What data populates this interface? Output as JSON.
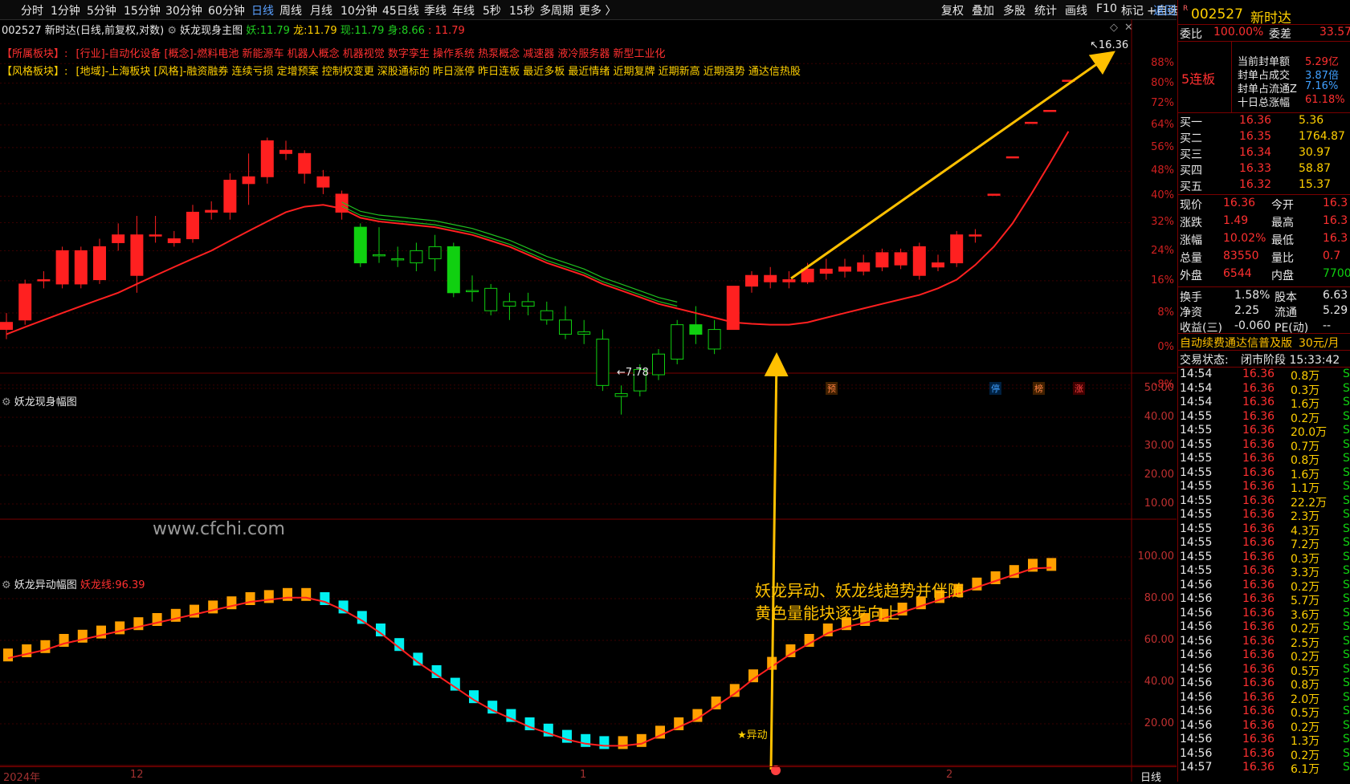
{
  "toolbar": {
    "periods": [
      "分时",
      "1分钟",
      "5分钟",
      "15分钟",
      "30分钟",
      "60分钟",
      "日线",
      "周线",
      "月线",
      "10分钟",
      "45日线",
      "季线",
      "年线",
      "5秒",
      "15秒",
      "多周期",
      "更多 〉"
    ],
    "active_period": "日线",
    "right_buttons": [
      "复权",
      "叠加",
      "多股",
      "统计",
      "画线",
      "F10",
      "标记",
      "+自选",
      "返回"
    ]
  },
  "chart_header": {
    "code": "002527",
    "name": "新时达",
    "mode": "(日线,前复权,对数)",
    "indicator": "妖龙现身主图",
    "yao_label": "妖:",
    "yao_value": "11.79",
    "long_label": "龙:",
    "long_value": "11.79",
    "xian_label": "现:",
    "xian_value": "11.79",
    "shen_label": "身:",
    "shen_value": "8.66",
    "shen_extra": ": 11.79"
  },
  "sectors": {
    "label1": "【所属板块】:",
    "text1": "[行业]-自动化设备 [概念]-燃料电池 新能源车 机器人概念 机器视觉 数字孪生 操作系统 热泵概念 减速器 液冷服务器 新型工业化",
    "label2": "【风格板块】:",
    "text2": "[地域]-上海板块 [风格]-融资融券 连续亏损 定增预案 控制权变更 深股通标的 昨日涨停 昨日连板 最近多板 最近情绪 近期复牌 近期新高 近期强势 通达信热股"
  },
  "main_axis": [
    "88%",
    "80%",
    "72%",
    "64%",
    "56%",
    "48%",
    "40%",
    "32%",
    "24%",
    "16%",
    "8%",
    "0%",
    "-8%"
  ],
  "price_labels": {
    "high": "16.36",
    "low": "7.78"
  },
  "badges": [
    "预",
    "停",
    "榜",
    "涨"
  ],
  "panel2": {
    "title": "妖龙现身幅图",
    "watermark": "www.cfchi.com",
    "axis": [
      "50.00",
      "40.00",
      "30.00",
      "20.00",
      "10.00"
    ]
  },
  "panel3": {
    "title": "妖龙异动幅图",
    "line_label": "妖龙线:",
    "line_value": "96.39",
    "axis": [
      "100.00",
      "80.00",
      "60.00",
      "40.00",
      "20.00"
    ],
    "annotation_line1": "妖龙异动、妖龙线趋势并伴随",
    "annotation_line2": "黄色量能块逐步向上",
    "signal_label": "异动"
  },
  "x_axis": {
    "labels": [
      "2024年",
      "12",
      "1",
      "2"
    ],
    "period": "日线"
  },
  "quote": {
    "code": "002527",
    "name": "新时达",
    "weibi_label": "委比",
    "weibi_value": "100.00%",
    "weicha_label": "委差",
    "weicha_value": "33.57",
    "lianban": "5连板",
    "seal_amount_label": "当前封单额",
    "seal_amount": "5.29亿",
    "seal_vol_label": "封单占成交",
    "seal_vol": "3.87倍",
    "seal_float_label": "封单占流通Z",
    "seal_float": "7.16%",
    "ten_day_label": "十日总涨幅",
    "ten_day": "61.18%",
    "bids": [
      {
        "label": "买一",
        "price": "16.36",
        "vol": "5.36"
      },
      {
        "label": "买二",
        "price": "16.35",
        "vol": "1764.87"
      },
      {
        "label": "买三",
        "price": "16.34",
        "vol": "30.97"
      },
      {
        "label": "买四",
        "price": "16.33",
        "vol": "58.87"
      },
      {
        "label": "买五",
        "price": "16.32",
        "vol": "15.37"
      }
    ],
    "stats": [
      {
        "l1": "现价",
        "v1": "16.36",
        "l2": "今开",
        "v2": "16.3"
      },
      {
        "l1": "涨跌",
        "v1": "1.49",
        "l2": "最高",
        "v2": "16.3"
      },
      {
        "l1": "涨幅",
        "v1": "10.02%",
        "l2": "最低",
        "v2": "16.3"
      },
      {
        "l1": "总量",
        "v1": "83550",
        "l2": "量比",
        "v2": "0.7"
      },
      {
        "l1": "外盘",
        "v1": "6544",
        "l2": "内盘",
        "v2": "7700"
      }
    ],
    "stats2": [
      {
        "l1": "换手",
        "v1": "1.58%",
        "l2": "股本",
        "v2": "6.63"
      },
      {
        "l1": "净资",
        "v1": "2.25",
        "l2": "流通",
        "v2": "5.29"
      },
      {
        "l1": "收益(三)",
        "v1": "-0.060",
        "l2": "PE(动)",
        "v2": "--"
      }
    ],
    "promo": "自动续费通达信普及版",
    "promo_price": "30元/月",
    "status_label": "交易状态:",
    "status_value": "闭市阶段 15:33:42"
  },
  "ticks": [
    {
      "t": "14:54",
      "p": "16.36",
      "v": "0.8万",
      "s": "S"
    },
    {
      "t": "14:54",
      "p": "16.36",
      "v": "0.3万",
      "s": "S"
    },
    {
      "t": "14:54",
      "p": "16.36",
      "v": "1.6万",
      "s": "S"
    },
    {
      "t": "14:55",
      "p": "16.36",
      "v": "0.2万",
      "s": "S"
    },
    {
      "t": "14:55",
      "p": "16.36",
      "v": "20.0万",
      "s": "S"
    },
    {
      "t": "14:55",
      "p": "16.36",
      "v": "0.7万",
      "s": "S"
    },
    {
      "t": "14:55",
      "p": "16.36",
      "v": "0.8万",
      "s": "S"
    },
    {
      "t": "14:55",
      "p": "16.36",
      "v": "1.6万",
      "s": "S"
    },
    {
      "t": "14:55",
      "p": "16.36",
      "v": "1.1万",
      "s": "S"
    },
    {
      "t": "14:55",
      "p": "16.36",
      "v": "22.2万",
      "s": "S"
    },
    {
      "t": "14:55",
      "p": "16.36",
      "v": "2.3万",
      "s": "S"
    },
    {
      "t": "14:55",
      "p": "16.36",
      "v": "4.3万",
      "s": "S"
    },
    {
      "t": "14:55",
      "p": "16.36",
      "v": "7.2万",
      "s": "S"
    },
    {
      "t": "14:55",
      "p": "16.36",
      "v": "0.3万",
      "s": "S"
    },
    {
      "t": "14:55",
      "p": "16.36",
      "v": "3.3万",
      "s": "S"
    },
    {
      "t": "14:56",
      "p": "16.36",
      "v": "0.2万",
      "s": "S"
    },
    {
      "t": "14:56",
      "p": "16.36",
      "v": "5.7万",
      "s": "S"
    },
    {
      "t": "14:56",
      "p": "16.36",
      "v": "3.6万",
      "s": "S"
    },
    {
      "t": "14:56",
      "p": "16.36",
      "v": "0.2万",
      "s": "S"
    },
    {
      "t": "14:56",
      "p": "16.36",
      "v": "2.5万",
      "s": "S"
    },
    {
      "t": "14:56",
      "p": "16.36",
      "v": "0.2万",
      "s": "S"
    },
    {
      "t": "14:56",
      "p": "16.36",
      "v": "0.5万",
      "s": "S"
    },
    {
      "t": "14:56",
      "p": "16.36",
      "v": "0.8万",
      "s": "S"
    },
    {
      "t": "14:56",
      "p": "16.36",
      "v": "2.0万",
      "s": "S"
    },
    {
      "t": "14:56",
      "p": "16.36",
      "v": "0.5万",
      "s": "S"
    },
    {
      "t": "14:56",
      "p": "16.36",
      "v": "0.2万",
      "s": "S"
    },
    {
      "t": "14:56",
      "p": "16.36",
      "v": "1.3万",
      "s": "S"
    },
    {
      "t": "14:56",
      "p": "16.36",
      "v": "0.2万",
      "s": "S"
    },
    {
      "t": "14:57",
      "p": "16.36",
      "v": "6.1万",
      "s": "S"
    }
  ],
  "chart_data": [
    {
      "type": "candlestick",
      "title": "妖龙现身主图",
      "candles": [
        {
          "o": 9.4,
          "c": 9.55,
          "h": 9.75,
          "l": 9.2
        },
        {
          "o": 9.6,
          "c": 10.4,
          "h": 10.5,
          "l": 9.5
        },
        {
          "o": 10.5,
          "c": 10.5,
          "h": 10.7,
          "l": 10.3
        },
        {
          "o": 10.4,
          "c": 11.2,
          "h": 11.3,
          "l": 10.3
        },
        {
          "o": 11.2,
          "c": 10.4,
          "h": 11.3,
          "l": 10.3
        },
        {
          "o": 10.5,
          "c": 11.3,
          "h": 11.5,
          "l": 10.4
        },
        {
          "o": 11.4,
          "c": 11.6,
          "h": 11.9,
          "l": 11.2
        },
        {
          "o": 11.6,
          "c": 10.6,
          "h": 12.1,
          "l": 10.2
        },
        {
          "o": 11.6,
          "c": 11.6,
          "h": 12.1,
          "l": 11.4
        },
        {
          "o": 11.4,
          "c": 11.5,
          "h": 11.7,
          "l": 11.3
        },
        {
          "o": 11.5,
          "c": 12.2,
          "h": 12.4,
          "l": 11.4
        },
        {
          "o": 12.2,
          "c": 12.25,
          "h": 12.5,
          "l": 12.0
        },
        {
          "o": 12.2,
          "c": 13.1,
          "h": 13.3,
          "l": 12.0
        },
        {
          "o": 13.0,
          "c": 13.2,
          "h": 13.9,
          "l": 12.4
        },
        {
          "o": 13.2,
          "c": 14.3,
          "h": 14.4,
          "l": 13.0
        },
        {
          "o": 14.0,
          "c": 13.9,
          "h": 14.3,
          "l": 13.7
        },
        {
          "o": 13.9,
          "c": 13.3,
          "h": 14.0,
          "l": 13.0
        },
        {
          "o": 13.2,
          "c": 12.9,
          "h": 13.4,
          "l": 12.7
        },
        {
          "o": 12.7,
          "c": 12.2,
          "h": 12.8,
          "l": 12.0
        },
        {
          "o": 11.8,
          "c": 10.9,
          "h": 11.9,
          "l": 10.8
        },
        {
          "o": 11.1,
          "c": 11.1,
          "h": 11.8,
          "l": 10.9
        },
        {
          "o": 11.0,
          "c": 11.0,
          "h": 11.3,
          "l": 10.8
        },
        {
          "o": 10.9,
          "c": 11.2,
          "h": 11.4,
          "l": 10.7
        },
        {
          "o": 11.0,
          "c": 11.3,
          "h": 11.6,
          "l": 10.7
        },
        {
          "o": 11.3,
          "c": 10.2,
          "h": 11.4,
          "l": 10.1
        },
        {
          "o": 10.25,
          "c": 10.25,
          "h": 10.6,
          "l": 10.0
        },
        {
          "o": 9.8,
          "c": 10.3,
          "h": 10.4,
          "l": 9.7
        },
        {
          "o": 9.9,
          "c": 10.0,
          "h": 10.2,
          "l": 9.6
        },
        {
          "o": 9.9,
          "c": 10.0,
          "h": 10.2,
          "l": 9.7
        },
        {
          "o": 9.6,
          "c": 9.8,
          "h": 10.0,
          "l": 9.5
        },
        {
          "o": 9.3,
          "c": 9.6,
          "h": 9.9,
          "l": 9.2
        },
        {
          "o": 9.3,
          "c": 9.35,
          "h": 9.6,
          "l": 9.1
        },
        {
          "o": 8.3,
          "c": 9.2,
          "h": 9.4,
          "l": 8.2
        },
        {
          "o": 8.1,
          "c": 8.15,
          "h": 8.3,
          "l": 7.78
        },
        {
          "o": 8.2,
          "c": 8.6,
          "h": 8.7,
          "l": 8.1
        },
        {
          "o": 8.5,
          "c": 8.9,
          "h": 9.0,
          "l": 8.4
        },
        {
          "o": 8.8,
          "c": 9.5,
          "h": 9.6,
          "l": 8.7
        },
        {
          "o": 9.5,
          "c": 9.3,
          "h": 9.9,
          "l": 9.1
        },
        {
          "o": 9.0,
          "c": 9.4,
          "h": 9.6,
          "l": 8.9
        },
        {
          "o": 9.4,
          "c": 10.35,
          "h": 10.35,
          "l": 9.4
        },
        {
          "o": 10.35,
          "c": 10.6,
          "h": 10.7,
          "l": 10.2
        },
        {
          "o": 10.45,
          "c": 10.6,
          "h": 10.8,
          "l": 10.3
        },
        {
          "o": 10.45,
          "c": 10.5,
          "h": 10.7,
          "l": 10.3
        },
        {
          "o": 10.45,
          "c": 10.75,
          "h": 10.9,
          "l": 10.4
        },
        {
          "o": 10.75,
          "c": 10.65,
          "h": 11.0,
          "l": 10.5
        },
        {
          "o": 10.7,
          "c": 10.8,
          "h": 11.0,
          "l": 10.55
        },
        {
          "o": 10.7,
          "c": 10.9,
          "h": 11.1,
          "l": 10.6
        },
        {
          "o": 11.15,
          "c": 10.8,
          "h": 11.25,
          "l": 10.7
        },
        {
          "o": 10.85,
          "c": 11.15,
          "h": 11.25,
          "l": 10.75
        },
        {
          "o": 10.6,
          "c": 11.3,
          "h": 11.4,
          "l": 10.5
        },
        {
          "o": 10.8,
          "c": 10.9,
          "h": 11.1,
          "l": 10.7
        },
        {
          "o": 11.6,
          "c": 10.9,
          "h": 11.7,
          "l": 10.8
        },
        {
          "o": 11.6,
          "c": 11.6,
          "h": 11.75,
          "l": 11.4
        },
        {
          "o": 12.7,
          "c": 12.7,
          "h": 12.7,
          "l": 12.7
        },
        {
          "o": 13.8,
          "c": 13.8,
          "h": 13.8,
          "l": 13.8
        },
        {
          "o": 14.9,
          "c": 14.9,
          "h": 14.9,
          "l": 14.9
        },
        {
          "o": 15.3,
          "c": 15.3,
          "h": 15.3,
          "l": 15.3
        },
        {
          "o": 16.36,
          "c": 16.36,
          "h": 16.36,
          "l": 16.36
        }
      ],
      "ma_red": [
        9.3,
        9.45,
        9.6,
        9.75,
        9.9,
        10.05,
        10.2,
        10.4,
        10.6,
        10.8,
        11.0,
        11.2,
        11.45,
        11.7,
        11.95,
        12.2,
        12.35,
        12.4,
        12.3,
        12.05,
        11.95,
        11.9,
        11.85,
        11.8,
        11.7,
        11.6,
        11.45,
        11.3,
        11.1,
        10.9,
        10.75,
        10.6,
        10.4,
        10.25,
        10.1,
        9.95,
        9.85,
        9.75,
        9.65,
        9.55,
        9.52,
        9.5,
        9.5,
        9.55,
        9.65,
        9.75,
        9.85,
        9.95,
        10.05,
        10.15,
        10.3,
        10.5,
        10.85,
        11.3,
        11.9,
        12.7,
        13.6,
        14.6
      ],
      "ylim": [
        8.5,
        17.6
      ]
    },
    {
      "type": "bar",
      "title": "妖龙异动幅图",
      "series": [
        {
          "name": "妖龙线",
          "values": [
            53,
            55,
            57,
            60,
            62,
            64,
            66,
            68,
            70,
            72,
            74,
            76,
            78,
            80,
            81,
            82,
            82,
            80,
            76,
            71,
            65,
            58,
            51,
            45,
            39,
            33,
            28,
            24,
            20,
            17,
            14,
            12,
            11,
            11,
            12,
            16,
            20,
            24,
            30,
            36,
            43,
            49,
            55,
            60,
            65,
            68,
            70,
            72,
            75,
            78,
            81,
            84,
            87,
            90,
            93,
            96,
            96.39
          ]
        }
      ],
      "colors": {
        "up": "#ffa000",
        "down": "#00f0f0"
      },
      "ylim": [
        0,
        115
      ]
    }
  ]
}
